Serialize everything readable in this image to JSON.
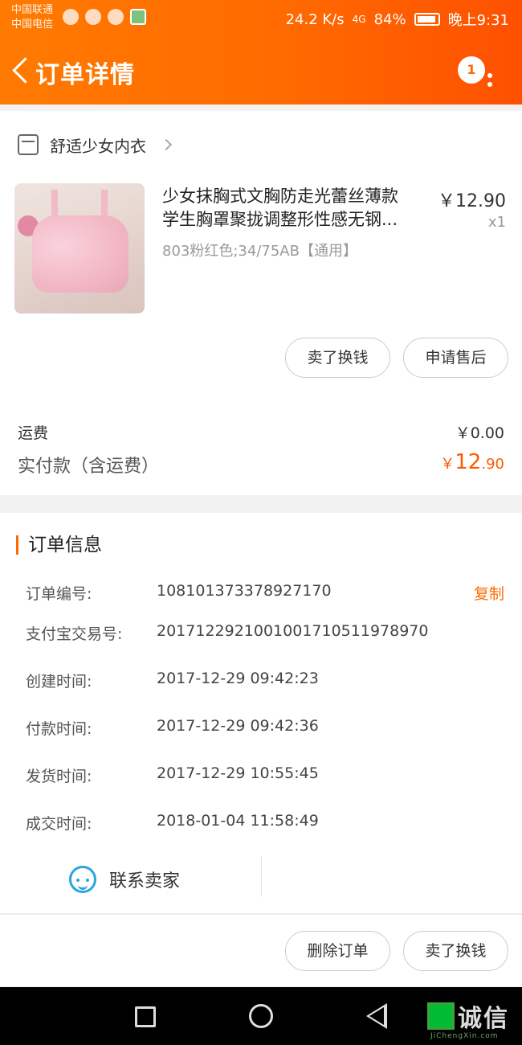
{
  "status_bar": {
    "carrier1": "中国联通",
    "carrier2": "中国电信",
    "speed": "24.2 K/s",
    "network": "4G",
    "battery": "84%",
    "time": "晚上9:31"
  },
  "header": {
    "title": "订单详情",
    "badge_count": "1",
    "bg_color": "#ff6a00"
  },
  "store": {
    "name": "舒适少女内衣"
  },
  "product": {
    "title_line1": "少女抹胸式文胸防走光蕾丝薄款",
    "title_line2": "学生胸罩聚拢调整形性感无钢...",
    "price": "￥12.90",
    "quantity": "x1",
    "spec": "803粉红色;34/75AB【通用】",
    "buttons": [
      "卖了换钱",
      "申请售后"
    ]
  },
  "totals": {
    "shipping_label": "运费",
    "shipping_value": "￥0.00",
    "paid_label": "实付款（含运费）",
    "paid_currency": "￥",
    "paid_int": "12",
    "paid_dec": ".90",
    "accent_color": "#ff5a00"
  },
  "order_info": {
    "title": "订单信息",
    "copy_label": "复制",
    "rows": [
      {
        "label": "订单编号:",
        "value": "108101373378927170"
      },
      {
        "label": "支付宝交易号:",
        "value": "2017122921001001710511978970"
      },
      {
        "label": "创建时间:",
        "value": "2017-12-29 09:42:23"
      },
      {
        "label": "付款时间:",
        "value": "2017-12-29 09:42:36"
      },
      {
        "label": "发货时间:",
        "value": "2017-12-29 10:55:45"
      },
      {
        "label": "成交时间:",
        "value": "2018-01-04 11:58:49"
      }
    ],
    "contact_label": "联系卖家"
  },
  "actions": {
    "delete_label": "删除订单",
    "sell_label": "卖了换钱"
  },
  "watermark": {
    "text": "诚信",
    "sub": "JiChengXin.com"
  }
}
